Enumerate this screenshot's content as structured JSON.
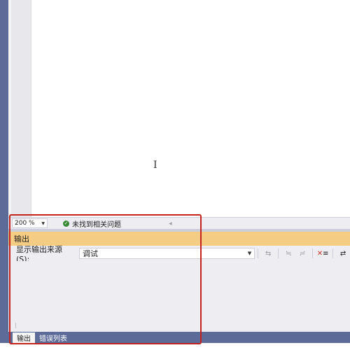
{
  "status_bar": {
    "zoom": "200 %",
    "issues_text": "未找到相关问题",
    "issues_icon": "check-circle-icon"
  },
  "output_panel": {
    "title": "输出",
    "source_label": "显示输出来源(S):",
    "source_value": "调试",
    "toolbar_icons": [
      "find-previous-icon",
      "find-next-icon",
      "go-to-location-icon",
      "clear-all-icon",
      "word-wrap-icon"
    ]
  },
  "bottom_tabs": [
    {
      "label": "输出",
      "active": true
    },
    {
      "label": "错误列表",
      "active": false
    }
  ],
  "colors": {
    "frame": "#5d6b99",
    "panel_title": "#f5cc84",
    "annotation_box": "#c4221c",
    "ok_green": "#388a34"
  }
}
